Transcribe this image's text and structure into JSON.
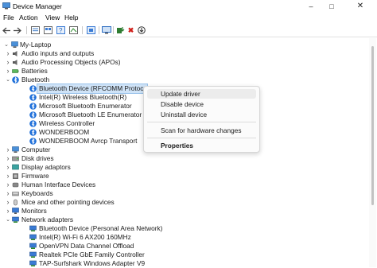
{
  "window": {
    "title": "Device Manager"
  },
  "menu": [
    "File",
    "Action",
    "View",
    "Help"
  ],
  "toolbar": {
    "buttons": [
      "back-icon",
      "forward-icon",
      "properties-icon",
      "view-icon",
      "help-icon",
      "scan-icon",
      "update-driver-icon",
      "uninstall-icon",
      "download-icon"
    ]
  },
  "tree": {
    "root": "My-Laptop",
    "items": [
      {
        "label": "Audio inputs and outputs",
        "level": 1,
        "expander": "collapsed",
        "icon": "speaker-icon"
      },
      {
        "label": "Audio Processing Objects (APOs)",
        "level": 1,
        "expander": "collapsed",
        "icon": "speaker-icon"
      },
      {
        "label": "Batteries",
        "level": 1,
        "expander": "collapsed",
        "icon": "battery-icon"
      },
      {
        "label": "Bluetooth",
        "level": 1,
        "expander": "expanded",
        "icon": "bluetooth-icon"
      },
      {
        "label": "Bluetooth Device (RFCOMM Protocol TDI)",
        "level": 2,
        "icon": "bluetooth-icon",
        "selected": true
      },
      {
        "label": "Intel(R) Wireless Bluetooth(R)",
        "level": 2,
        "icon": "bluetooth-icon"
      },
      {
        "label": "Microsoft Bluetooth Enumerator",
        "level": 2,
        "icon": "bluetooth-icon"
      },
      {
        "label": "Microsoft Bluetooth LE Enumerator",
        "level": 2,
        "icon": "bluetooth-icon"
      },
      {
        "label": "Wireless Controller",
        "level": 2,
        "icon": "bluetooth-icon"
      },
      {
        "label": "WONDERBOOM",
        "level": 2,
        "icon": "bluetooth-icon"
      },
      {
        "label": "WONDERBOOM Avrcp Transport",
        "level": 2,
        "icon": "bluetooth-icon"
      },
      {
        "label": "Computer",
        "level": 1,
        "expander": "collapsed",
        "icon": "computer-icon"
      },
      {
        "label": "Disk drives",
        "level": 1,
        "expander": "collapsed",
        "icon": "disk-icon"
      },
      {
        "label": "Display adaptors",
        "level": 1,
        "expander": "collapsed",
        "icon": "display-icon"
      },
      {
        "label": "Firmware",
        "level": 1,
        "expander": "collapsed",
        "icon": "firmware-icon"
      },
      {
        "label": "Human Interface Devices",
        "level": 1,
        "expander": "collapsed",
        "icon": "hid-icon"
      },
      {
        "label": "Keyboards",
        "level": 1,
        "expander": "collapsed",
        "icon": "keyboard-icon"
      },
      {
        "label": "Mice and other pointing devices",
        "level": 1,
        "expander": "collapsed",
        "icon": "mouse-icon"
      },
      {
        "label": "Monitors",
        "level": 1,
        "expander": "collapsed",
        "icon": "monitor-icon"
      },
      {
        "label": "Network adapters",
        "level": 1,
        "expander": "expanded",
        "icon": "network-icon"
      },
      {
        "label": "Bluetooth Device (Personal Area Network)",
        "level": 2,
        "icon": "network-icon"
      },
      {
        "label": "Intel(R) Wi-Fi 6 AX200 160MHz",
        "level": 2,
        "icon": "network-icon"
      },
      {
        "label": "OpenVPN Data Channel Offload",
        "level": 2,
        "icon": "network-icon"
      },
      {
        "label": "Realtek PCIe GbE Family Controller",
        "level": 2,
        "icon": "network-icon"
      },
      {
        "label": "TAP-Surfshark Windows Adapter V9",
        "level": 2,
        "icon": "network-icon"
      }
    ]
  },
  "context_menu": {
    "items": [
      "Update driver",
      "Disable device",
      "Uninstall device",
      "Scan for hardware changes",
      "Properties"
    ]
  },
  "colors": {
    "accent": "#1e6fd9",
    "selection": "#cfe3f7",
    "uninstall_red": "#d0201a"
  }
}
